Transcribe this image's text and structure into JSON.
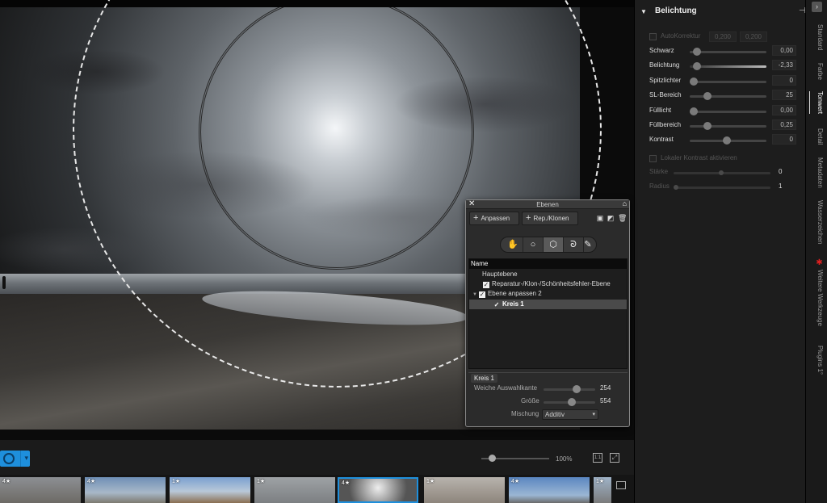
{
  "panel": {
    "title": "Belichtung",
    "autokorrektur": {
      "label": "AutoKorrektur",
      "field1": "0,200",
      "field2": "0,200"
    },
    "sliders": [
      {
        "label": "Schwarz",
        "value": "0,00",
        "level": 0.05
      },
      {
        "label": "Belichtung",
        "value": "-2,33",
        "level": 0.05
      },
      {
        "label": "Spitzlichter",
        "value": "0",
        "level": 0.0
      },
      {
        "label": "SL-Bereich",
        "value": "25",
        "level": 0.2
      },
      {
        "label": "Fülllicht",
        "value": "0,00",
        "level": 0.0
      },
      {
        "label": "Füllbereich",
        "value": "0,25",
        "level": 0.2
      },
      {
        "label": "Kontrast",
        "value": "0",
        "level": 0.48
      }
    ],
    "lokaler_kontrast": {
      "label": "Lokaler Kontrast aktivieren"
    },
    "staerke": {
      "label": "Stärke",
      "value": "0"
    },
    "radius": {
      "label": "Radius",
      "value": "1"
    }
  },
  "tabs": [
    "Standard",
    "Farbe",
    "Tonwert",
    "Detail",
    "Metadaten",
    "Wasserzeichen",
    "Weitere Werkzeuge",
    "Plugins 1°"
  ],
  "active_tab": "Tonwert",
  "ebenen": {
    "title": "Ebenen",
    "btn_anpassen": "Anpassen",
    "btn_rep": "Rep./Klonen",
    "list_header": "Name",
    "layers": [
      {
        "name": "Hauptebene",
        "checked": false,
        "indent": 1
      },
      {
        "name": "Reparatur-/Klon-/Schönheitsfehler-Ebene",
        "checked": true,
        "indent": 1
      },
      {
        "name": "Ebene anpassen 2",
        "checked": true,
        "indent": 0,
        "expanded": true
      },
      {
        "name": "Kreis 1",
        "checked": true,
        "indent": 2,
        "selected": true
      }
    ],
    "kreis_title": "Kreis 1",
    "weiche": {
      "label": "Weiche Auswahlkante",
      "value": "254",
      "level": 0.72
    },
    "groesse": {
      "label": "Größe",
      "value": "554",
      "level": 0.6
    },
    "mischung": {
      "label": "Mischung",
      "value": "Additiv"
    }
  },
  "zoom": {
    "label": "100%",
    "fit": "1:1"
  },
  "thumbnails": [
    {
      "stars": "4★"
    },
    {
      "stars": "4★"
    },
    {
      "stars": "1★"
    },
    {
      "stars": "1★"
    },
    {
      "stars": "4★"
    },
    {
      "stars": "1★"
    },
    {
      "stars": "4★"
    },
    {
      "stars": "1★"
    }
  ],
  "colors": {
    "accent": "#1e8fdc",
    "panel_bg": "#1d1d1d",
    "tab_star": "#e02020"
  }
}
